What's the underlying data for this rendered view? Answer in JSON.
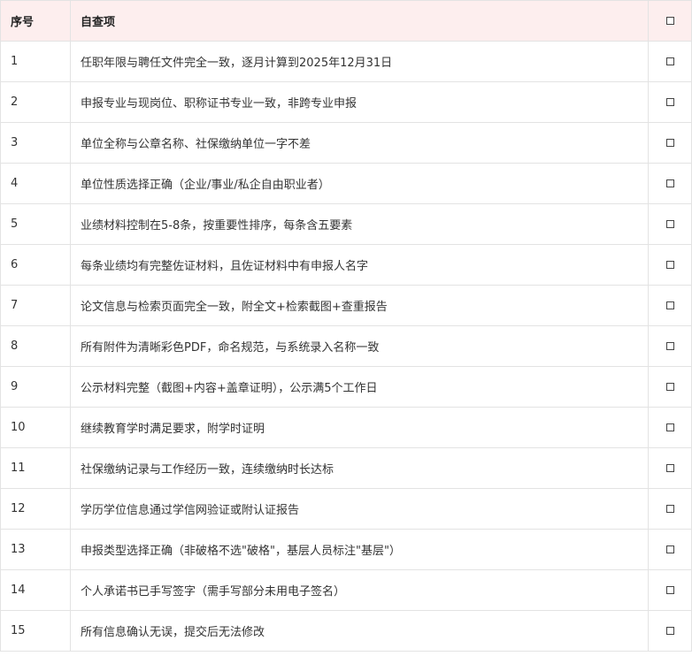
{
  "table": {
    "headers": {
      "index": "序号",
      "item": "自查项",
      "check": ""
    },
    "check_glyph": "□",
    "rows": [
      {
        "index": "1",
        "item": "任职年限与聘任文件完全一致，逐月计算到2025年12月31日",
        "checked": false
      },
      {
        "index": "2",
        "item": "申报专业与现岗位、职称证书专业一致，非跨专业申报",
        "checked": false
      },
      {
        "index": "3",
        "item": "单位全称与公章名称、社保缴纳单位一字不差",
        "checked": false
      },
      {
        "index": "4",
        "item": "单位性质选择正确（企业/事业/私企自由职业者）",
        "checked": false
      },
      {
        "index": "5",
        "item": "业绩材料控制在5-8条，按重要性排序，每条含五要素",
        "checked": false
      },
      {
        "index": "6",
        "item": "每条业绩均有完整佐证材料，且佐证材料中有申报人名字",
        "checked": false
      },
      {
        "index": "7",
        "item": "论文信息与检索页面完全一致，附全文+检索截图+查重报告",
        "checked": false
      },
      {
        "index": "8",
        "item": "所有附件为清晰彩色PDF，命名规范，与系统录入名称一致",
        "checked": false
      },
      {
        "index": "9",
        "item": "公示材料完整（截图+内容+盖章证明），公示满5个工作日",
        "checked": false
      },
      {
        "index": "10",
        "item": "继续教育学时满足要求，附学时证明",
        "checked": false
      },
      {
        "index": "11",
        "item": "社保缴纳记录与工作经历一致，连续缴纳时长达标",
        "checked": false
      },
      {
        "index": "12",
        "item": "学历学位信息通过学信网验证或附认证报告",
        "checked": false
      },
      {
        "index": "13",
        "item": "申报类型选择正确（非破格不选\"破格\"，基层人员标注\"基层\"）",
        "checked": false
      },
      {
        "index": "14",
        "item": "个人承诺书已手写签字（需手写部分未用电子签名）",
        "checked": false
      },
      {
        "index": "15",
        "item": "所有信息确认无误，提交后无法修改",
        "checked": false
      }
    ]
  },
  "colors": {
    "header_background": "#fdeeee",
    "border": "#e3e3e3",
    "text": "#333333"
  }
}
